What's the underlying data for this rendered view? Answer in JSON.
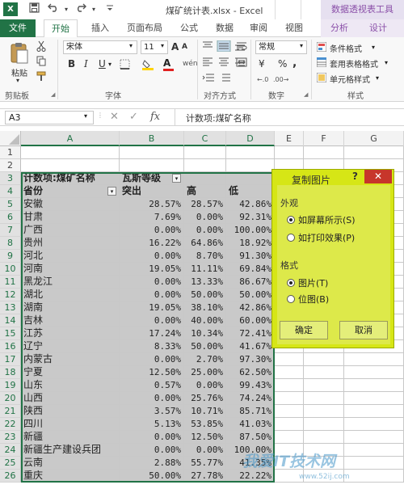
{
  "titlebar": {
    "app_icon": "X",
    "save_icon": "save-icon",
    "undo_icon": "undo-icon",
    "redo_icon": "redo-icon",
    "title": "煤矿统计表.xlsx - Excel",
    "context_header": "数据透视表工具"
  },
  "tabs": {
    "file": "文件",
    "home": "开始",
    "insert": "插入",
    "page_layout": "页面布局",
    "formulas": "公式",
    "data": "数据",
    "review": "审阅",
    "view": "视图",
    "analyze": "分析",
    "design": "设计"
  },
  "ribbon": {
    "paste": "粘贴",
    "clipboard": "剪贴板",
    "font_name": "宋体",
    "font_size": "11",
    "font_group": "字体",
    "bold": "B",
    "italic": "I",
    "underline": "U",
    "grow_font": "A",
    "shrink_font": "A",
    "wen": "wén",
    "align_group": "对齐方式",
    "number_format": "常规",
    "percent": "%",
    "comma": ",",
    "currency": "¥",
    "number_group": "数字",
    "cond_format": "条件格式",
    "table_format": "套用表格格式",
    "cell_style": "单元格样式",
    "style_group": "样式"
  },
  "formula_bar": {
    "name_box": "A3",
    "fx": "fx",
    "cancel": "✕",
    "enter": "✓",
    "formula": "计数项:煤矿名称"
  },
  "columns": [
    "A",
    "B",
    "C",
    "D",
    "E",
    "F",
    "G"
  ],
  "rows": [
    "1",
    "2",
    "3",
    "4",
    "5",
    "6",
    "7",
    "8",
    "9",
    "10",
    "11",
    "12",
    "13",
    "14",
    "15",
    "16",
    "17",
    "18",
    "19",
    "20",
    "21",
    "22",
    "23",
    "24",
    "25",
    "26"
  ],
  "pivot": {
    "corner_label": "计数项:煤矿名称",
    "col_field": "瓦斯等级",
    "row_field": "省份",
    "headers": [
      "突出",
      "高",
      "低"
    ],
    "data": [
      [
        "安徽",
        "28.57%",
        "28.57%",
        "42.86%"
      ],
      [
        "甘肃",
        "7.69%",
        "0.00%",
        "92.31%"
      ],
      [
        "广西",
        "0.00%",
        "0.00%",
        "100.00%"
      ],
      [
        "贵州",
        "16.22%",
        "64.86%",
        "18.92%"
      ],
      [
        "河北",
        "0.00%",
        "8.70%",
        "91.30%"
      ],
      [
        "河南",
        "19.05%",
        "11.11%",
        "69.84%"
      ],
      [
        "黑龙江",
        "0.00%",
        "13.33%",
        "86.67%"
      ],
      [
        "湖北",
        "0.00%",
        "50.00%",
        "50.00%"
      ],
      [
        "湖南",
        "19.05%",
        "38.10%",
        "42.86%"
      ],
      [
        "吉林",
        "0.00%",
        "40.00%",
        "60.00%"
      ],
      [
        "江苏",
        "17.24%",
        "10.34%",
        "72.41%"
      ],
      [
        "辽宁",
        "8.33%",
        "50.00%",
        "41.67%"
      ],
      [
        "内蒙古",
        "0.00%",
        "2.70%",
        "97.30%"
      ],
      [
        "宁夏",
        "12.50%",
        "25.00%",
        "62.50%"
      ],
      [
        "山东",
        "0.57%",
        "0.00%",
        "99.43%"
      ],
      [
        "山西",
        "0.00%",
        "25.76%",
        "74.24%"
      ],
      [
        "陕西",
        "3.57%",
        "10.71%",
        "85.71%"
      ],
      [
        "四川",
        "5.13%",
        "53.85%",
        "41.03%"
      ],
      [
        "新疆",
        "0.00%",
        "12.50%",
        "87.50%"
      ],
      [
        "新疆生产建设兵团",
        "0.00%",
        "0.00%",
        "100.00%"
      ],
      [
        "云南",
        "2.88%",
        "55.77%",
        "41.35%"
      ],
      [
        "重庆",
        "50.00%",
        "27.78%",
        "22.22%"
      ]
    ]
  },
  "dialog": {
    "title": "复制图片",
    "help": "?",
    "close": "✕",
    "appearance_label": "外观",
    "as_on_screen": "如屏幕所示(S)",
    "as_printed": "如打印效果(P)",
    "format_label": "格式",
    "picture": "图片(T)",
    "bitmap": "位图(B)",
    "ok": "确定",
    "cancel": "取消"
  },
  "watermark": {
    "text": "我爱IT技术网",
    "url": "www.52ij.com"
  },
  "colors": {
    "excel_green": "#217346",
    "dialog_yellow": "#d6e616",
    "selection_gray": "#c9c9c9",
    "close_red": "#c7362b"
  }
}
